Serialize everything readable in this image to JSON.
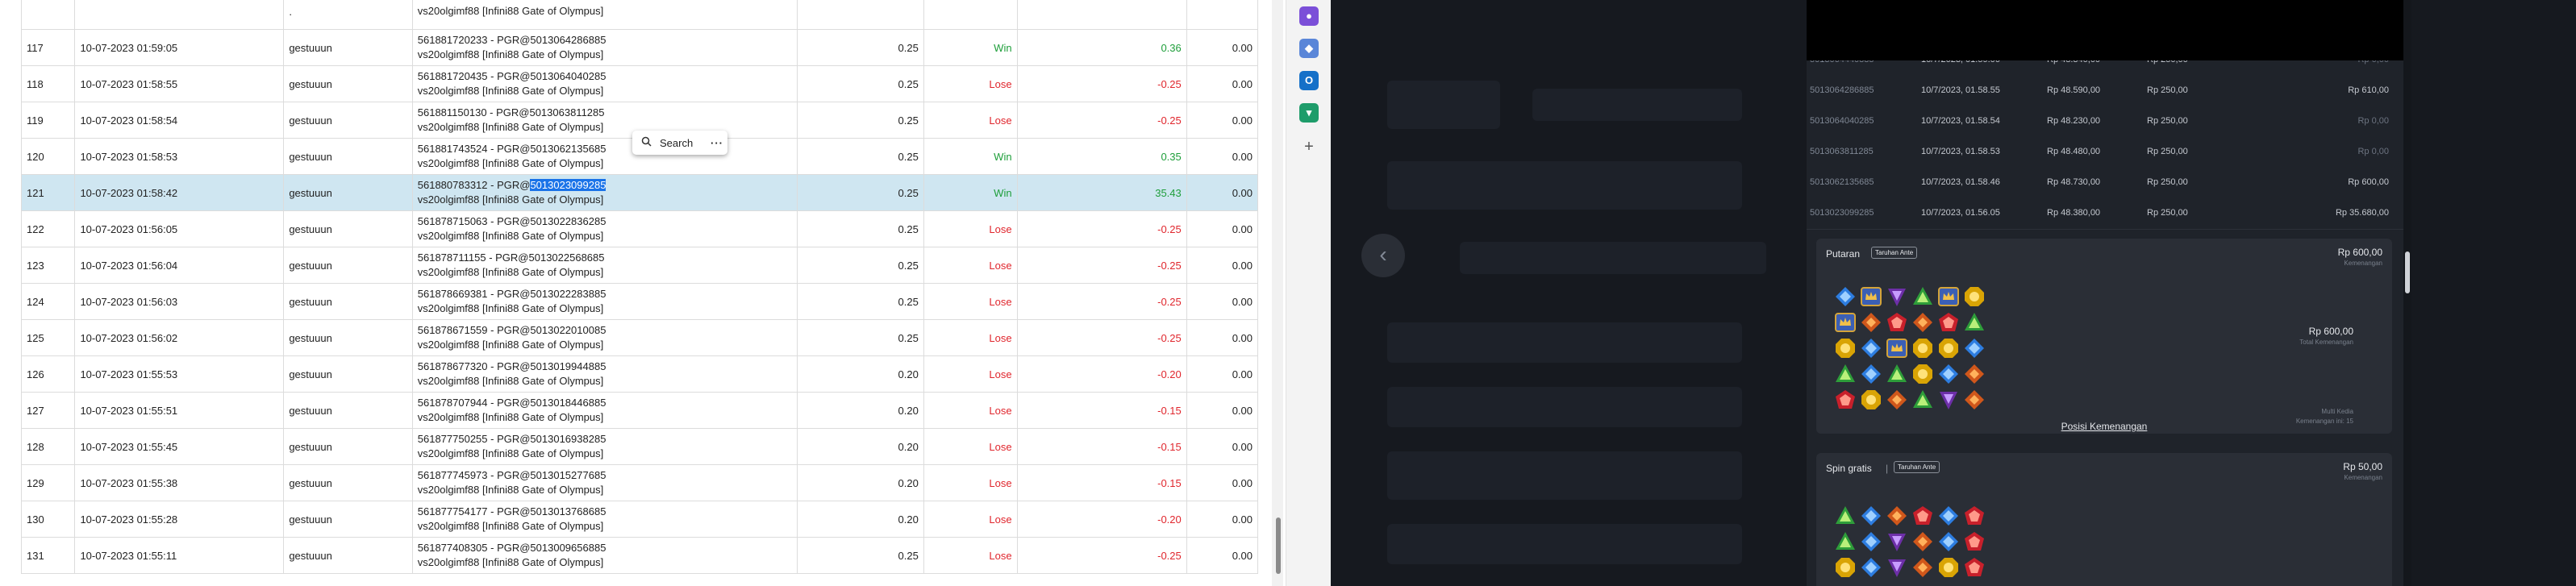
{
  "transactions": [
    {
      "no": "117",
      "time": "10-07-2023 01:59:05",
      "user": "gestuuun",
      "desc1": "561881720233 - PGR@5013064286885",
      "desc2": "vs20olgimf88 [Infini88 Gate of Olympus]",
      "bet": "0.25",
      "result": "Win",
      "win": "0.36",
      "balance": "0.00"
    },
    {
      "no": "118",
      "time": "10-07-2023 01:58:55",
      "user": "gestuuun",
      "desc1": "561881720435 - PGR@5013064040285",
      "desc2": "vs20olgimf88 [Infini88 Gate of Olympus]",
      "bet": "0.25",
      "result": "Lose",
      "win": "-0.25",
      "balance": "0.00"
    },
    {
      "no": "119",
      "time": "10-07-2023 01:58:54",
      "user": "gestuuun",
      "desc1": "561881150130 - PGR@5013063811285",
      "desc2": "vs20olgimf88 [Infini88 Gate of Olympus]",
      "bet": "0.25",
      "result": "Lose",
      "win": "-0.25",
      "balance": "0.00"
    },
    {
      "no": "120",
      "time": "10-07-2023 01:58:53",
      "user": "gestuuun",
      "desc1": "561881743524 - PGR@5013062135685",
      "desc2": "vs20olgimf88 [Infini88 Gate of Olympus]",
      "bet": "0.25",
      "result": "Win",
      "win": "0.35",
      "balance": "0.00"
    },
    {
      "no": "121",
      "time": "10-07-2023 01:58:42",
      "user": "gestuuun",
      "desc1_prefix": "561880783312 - PGR@",
      "desc1_hl": "5013023099285",
      "desc2": "vs20olgimf88 [Infini88 Gate of Olympus]",
      "bet": "0.25",
      "result": "Win",
      "win": "35.43",
      "balance": "0.00"
    },
    {
      "no": "122",
      "time": "10-07-2023 01:56:05",
      "user": "gestuuun",
      "desc1": "561878715063 - PGR@5013022836285",
      "desc2": "vs20olgimf88 [Infini88 Gate of Olympus]",
      "bet": "0.25",
      "result": "Lose",
      "win": "-0.25",
      "balance": "0.00"
    },
    {
      "no": "123",
      "time": "10-07-2023 01:56:04",
      "user": "gestuuun",
      "desc1": "561878711155 - PGR@5013022568685",
      "desc2": "vs20olgimf88 [Infini88 Gate of Olympus]",
      "bet": "0.25",
      "result": "Lose",
      "win": "-0.25",
      "balance": "0.00"
    },
    {
      "no": "124",
      "time": "10-07-2023 01:56:03",
      "user": "gestuuun",
      "desc1": "561878669381 - PGR@5013022283885",
      "desc2": "vs20olgimf88 [Infini88 Gate of Olympus]",
      "bet": "0.25",
      "result": "Lose",
      "win": "-0.25",
      "balance": "0.00"
    },
    {
      "no": "125",
      "time": "10-07-2023 01:56:02",
      "user": "gestuuun",
      "desc1": "561878671559 - PGR@5013022010085",
      "desc2": "vs20olgimf88 [Infini88 Gate of Olympus]",
      "bet": "0.25",
      "result": "Lose",
      "win": "-0.25",
      "balance": "0.00"
    },
    {
      "no": "126",
      "time": "10-07-2023 01:55:53",
      "user": "gestuuun",
      "desc1": "561878677320 - PGR@5013019944885",
      "desc2": "vs20olgimf88 [Infini88 Gate of Olympus]",
      "bet": "0.20",
      "result": "Lose",
      "win": "-0.20",
      "balance": "0.00"
    },
    {
      "no": "127",
      "time": "10-07-2023 01:55:51",
      "user": "gestuuun",
      "desc1": "561878707944 - PGR@5013018446885",
      "desc2": "vs20olgimf88 [Infini88 Gate of Olympus]",
      "bet": "0.20",
      "result": "Lose",
      "win": "-0.15",
      "balance": "0.00"
    },
    {
      "no": "128",
      "time": "10-07-2023 01:55:45",
      "user": "gestuuun",
      "desc1": "561877750255 - PGR@5013016938285",
      "desc2": "vs20olgimf88 [Infini88 Gate of Olympus]",
      "bet": "0.20",
      "result": "Lose",
      "win": "-0.15",
      "balance": "0.00"
    },
    {
      "no": "129",
      "time": "10-07-2023 01:55:38",
      "user": "gestuuun",
      "desc1": "561877745973 - PGR@5013015277685",
      "desc2": "vs20olgimf88 [Infini88 Gate of Olympus]",
      "bet": "0.20",
      "result": "Lose",
      "win": "-0.15",
      "balance": "0.00"
    },
    {
      "no": "130",
      "time": "10-07-2023 01:55:28",
      "user": "gestuuun",
      "desc1": "561877754177 - PGR@5013013768685",
      "desc2": "vs20olgimf88 [Infini88 Gate of Olympus]",
      "bet": "0.20",
      "result": "Lose",
      "win": "-0.20",
      "balance": "0.00"
    },
    {
      "no": "131",
      "time": "10-07-2023 01:55:11",
      "user": "gestuuun",
      "desc1": "561877408305 - PGR@5013009656885",
      "desc2": "vs20olgimf88 [Infini88 Gate of Olympus]",
      "bet": "0.25",
      "result": "Lose",
      "win": "-0.25",
      "balance": "0.00"
    }
  ],
  "top_partial_row": {
    "desc2": "vs20olgimf88 [Infini88 Gate of Olympus]"
  },
  "context_menu": {
    "search_label": "Search",
    "more_label": "···"
  },
  "browser_sidebar": {
    "add_label": "+"
  },
  "history": {
    "partial_row": {
      "id": "5013064440885",
      "time": "10/7/2023, 01.59.06",
      "balance": "Rp 48.340,00",
      "bet": "Rp 250,00",
      "win": "Rp 0,00"
    },
    "rows": [
      {
        "id": "5013064286885",
        "time": "10/7/2023, 01.58.55",
        "balance": "Rp 48.590,00",
        "bet": "Rp 250,00",
        "win": "Rp 610,00"
      },
      {
        "id": "5013064040285",
        "time": "10/7/2023, 01.58.54",
        "balance": "Rp 48.230,00",
        "bet": "Rp 250,00",
        "win": "Rp 0,00"
      },
      {
        "id": "5013063811285",
        "time": "10/7/2023, 01.58.53",
        "balance": "Rp 48.480,00",
        "bet": "Rp 250,00",
        "win": "Rp 0,00"
      },
      {
        "id": "5013062135685",
        "time": "10/7/2023, 01.58.46",
        "balance": "Rp 48.730,00",
        "bet": "Rp 250,00",
        "win": "Rp 600,00"
      },
      {
        "id": "5013023099285",
        "time": "10/7/2023, 01.56.05",
        "balance": "Rp 48.380,00",
        "bet": "Rp 250,00",
        "win": "Rp 35.680,00"
      }
    ],
    "putaran": {
      "title": "Putaran",
      "tag": "Taruhan Ante",
      "amount": "Rp 600,00",
      "amount_sub": "Kemenangan",
      "mid_amount": "Rp 600,00",
      "mid_sub": "Total Kemenangan",
      "side1": "Multi Kedia",
      "side2": "Kemenangan ini: 15",
      "link": "Posisi Kemenangan",
      "grid": [
        [
          "blue",
          "crown",
          "purple",
          "green",
          "crown",
          "yellow"
        ],
        [
          "crown",
          "orange",
          "red",
          "orange",
          "red",
          "green"
        ],
        [
          "yellow",
          "blue",
          "crown",
          "yellow",
          "yellow",
          "blue"
        ],
        [
          "green",
          "blue",
          "green",
          "yellow",
          "blue",
          "orange"
        ],
        [
          "red",
          "yellow",
          "orange",
          "green",
          "purple",
          "orange"
        ]
      ]
    },
    "spin": {
      "title": "Spin gratis",
      "sep": "|",
      "tag": "Taruhan Ante",
      "amount": "Rp 50,00",
      "amount_sub": "Kemenangan",
      "grid": [
        [
          "green",
          "blue",
          "orange",
          "red",
          "blue",
          "red"
        ],
        [
          "green",
          "blue",
          "purple",
          "orange",
          "blue",
          "red"
        ],
        [
          "yellow",
          "blue",
          "purple",
          "orange",
          "yellow",
          "red"
        ]
      ]
    }
  },
  "colors": {
    "win": "#1e9e3a",
    "lose": "#e0262d",
    "selection": "#cfe6f1",
    "highlight": "#1a73e8",
    "panel_bg": "#1f232a",
    "page_dark": "#16191f"
  },
  "icons": {
    "popup": "search-icon",
    "back": "chevron-left-icon",
    "sidebar": [
      "copilot-icon",
      "extension-icon",
      "outlook-icon",
      "shopping-icon",
      "add-icon"
    ]
  }
}
